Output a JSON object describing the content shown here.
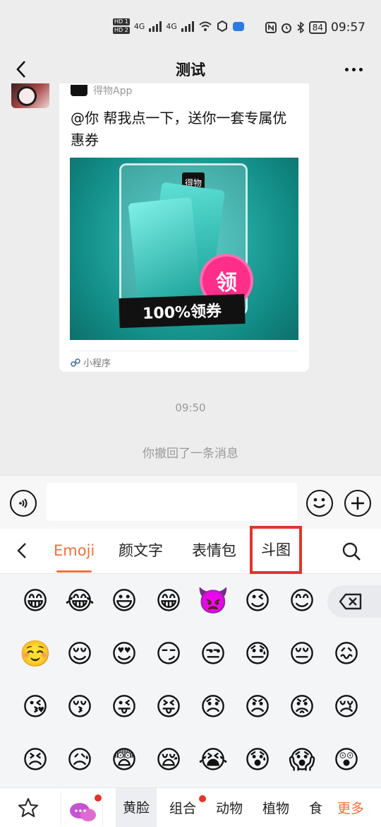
{
  "status_bar": {
    "hd1": "HD 1",
    "hd2": "HD 2",
    "net1": "4G",
    "net2": "4G",
    "battery": "84",
    "time": "09:57"
  },
  "header": {
    "title": "测试"
  },
  "message": {
    "source": "得物App",
    "text": "@你 帮我点一下，送你一套专属优惠券",
    "image_badge": "领",
    "image_banner": "100%领券",
    "image_logo": "得物",
    "footer": "小程序",
    "colors": {
      "image_bg": "#128c86",
      "badge": "#ff2e8a"
    }
  },
  "chat": {
    "time": "09:50",
    "recall_notice": "你撤回了一条消息"
  },
  "input": {
    "value": "",
    "placeholder": ""
  },
  "keyboard": {
    "tabs": [
      "Emoji",
      "颜文字",
      "表情包",
      "斗图"
    ],
    "active_tab": "Emoji",
    "highlighted_tab": "斗图",
    "emojis": [
      [
        "😁",
        "😂",
        "😃",
        "😁",
        "👿",
        "😉",
        "😊"
      ],
      [
        "☺️",
        "😌",
        "😍",
        "😏",
        "😒",
        "😓",
        "😔",
        "😖"
      ],
      [
        "😘",
        "😚",
        "😜",
        "😝",
        "😞",
        "😠",
        "😡",
        "😢"
      ],
      [
        "😣",
        "😥",
        "😨",
        "😪",
        "😭",
        "😰",
        "😱",
        "😲"
      ]
    ],
    "bottom": {
      "categories": [
        "黄脸",
        "组合",
        "动物",
        "植物",
        "食"
      ],
      "selected": "黄脸",
      "more": "更多"
    },
    "accent_color": "#f2703b",
    "highlight_color": "#e5332a"
  }
}
